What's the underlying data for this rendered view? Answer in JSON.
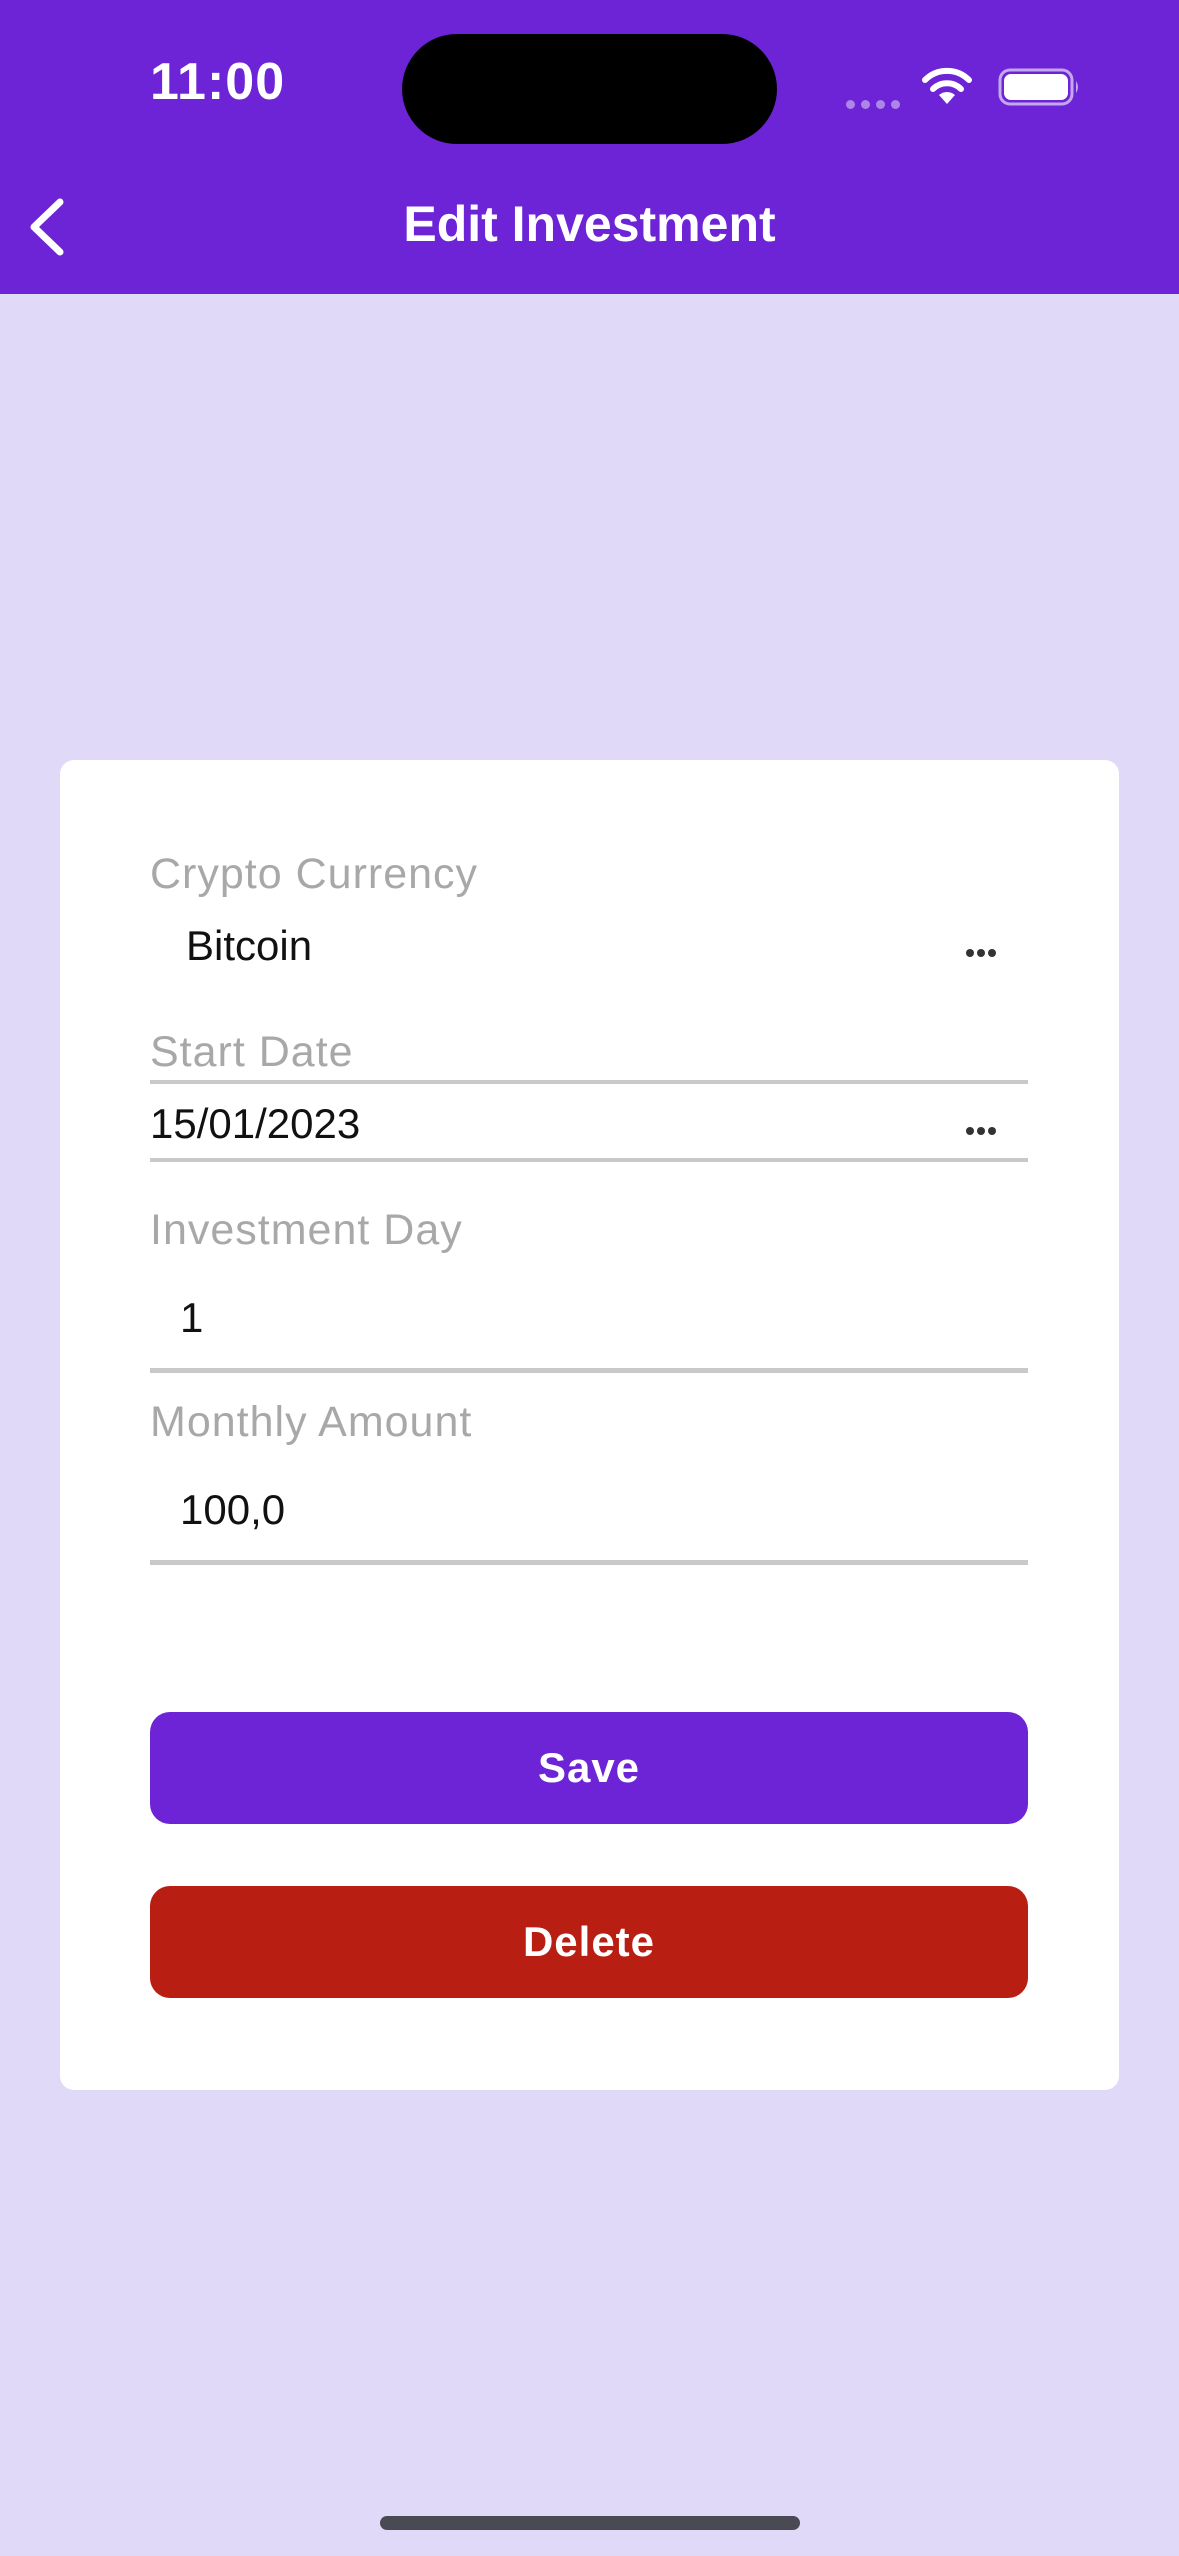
{
  "status_bar": {
    "time": "11:00"
  },
  "nav": {
    "title": "Edit Investment",
    "back_icon": "chevron-left-icon"
  },
  "form": {
    "crypto_currency": {
      "label": "Crypto Currency",
      "value": "Bitcoin",
      "icon": "more-horizontal-icon"
    },
    "start_date": {
      "label": "Start Date",
      "value": "15/01/2023",
      "icon": "more-horizontal-icon"
    },
    "investment_day": {
      "label": "Investment Day",
      "value": "1"
    },
    "monthly_amount": {
      "label": "Monthly Amount",
      "value": "100,0"
    }
  },
  "actions": {
    "save_label": "Save",
    "delete_label": "Delete"
  },
  "colors": {
    "header": "#6C24D6",
    "background": "#E0D9F8",
    "save": "#6C24D6",
    "delete": "#B91E12"
  }
}
